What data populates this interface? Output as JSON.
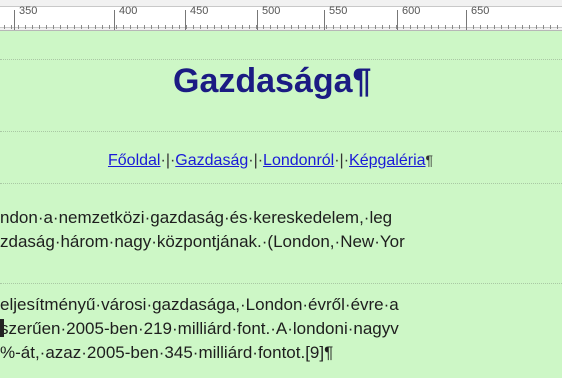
{
  "ruler": {
    "labels": [
      "350",
      "400",
      "450",
      "500",
      "550",
      "600",
      "650"
    ]
  },
  "document": {
    "heading": "Gazdasága",
    "heading_mark": "¶",
    "nav": {
      "link1": "Főoldal",
      "sep1": "·|·",
      "link2": "Gazdaság",
      "sep2": "·|·",
      "link3": "Londonról",
      "sep3": "·|·",
      "link4": "Képgaléria",
      "mark": "¶"
    },
    "para1_line1": "ndon·a·nemzetközi·gazdaság·és·kereskedelem,·leg",
    "para1_line2": "zdaság·három·nagy·központjának.·(London,·New·Yor",
    "para2_line1": "eljesítményű·városi·gazdasága,·London·évről·évre·a",
    "para2_line2": "szerűen·2005-ben·219·milliárd·font.·A·londoni·nagyv",
    "para2_line3": "%-át,·azaz·2005-ben·345·milliárd·fontot.[9]¶"
  },
  "colors": {
    "page_bg": "#cdf7c6",
    "heading": "#1b1b83",
    "link": "#1a1ad8"
  }
}
